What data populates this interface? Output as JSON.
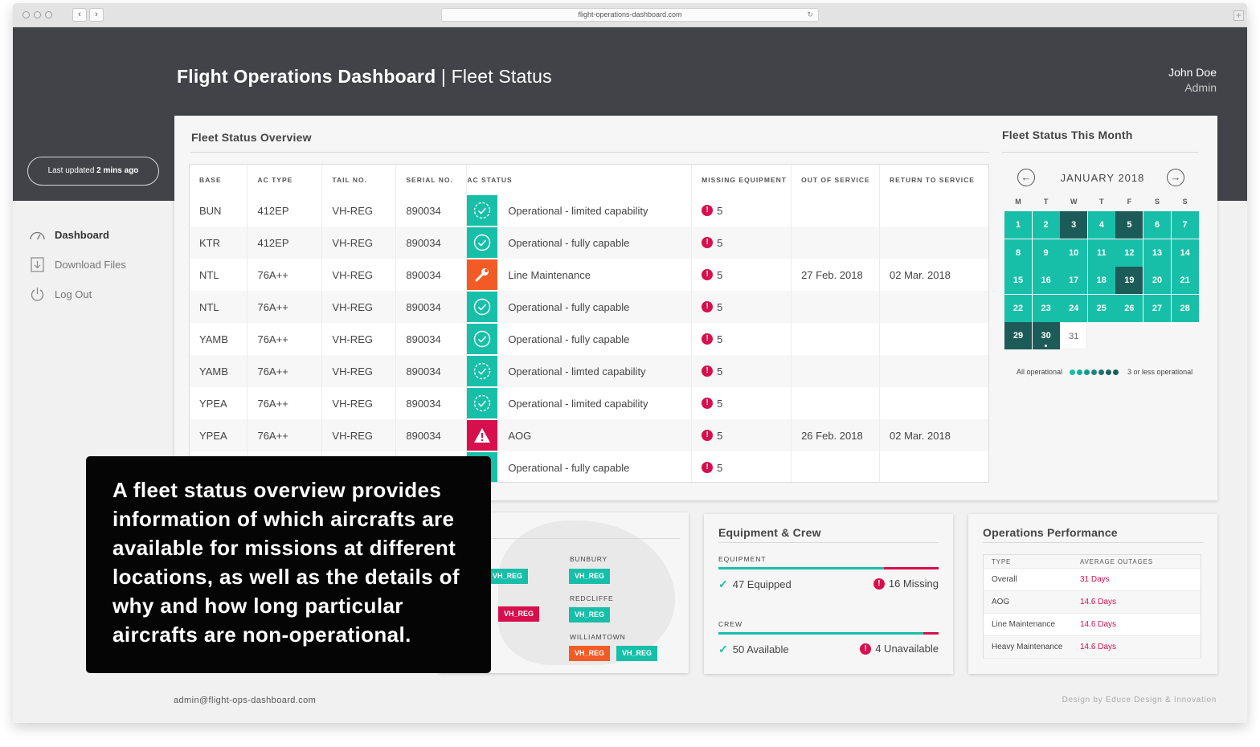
{
  "browser": {
    "url": "flight-operations-dashboard.com"
  },
  "header": {
    "title_main": "Flight Operations Dashboard",
    "title_sep": " | ",
    "title_sub": "Fleet Status",
    "user_name": "John Doe",
    "user_role": "Admin"
  },
  "sidebar": {
    "last_updated_prefix": "Last updated ",
    "last_updated_value": "2 mins ago",
    "items": [
      {
        "label": "Dashboard",
        "icon": "gauge-icon"
      },
      {
        "label": "Download Files",
        "icon": "download-icon"
      },
      {
        "label": "Log Out",
        "icon": "power-icon"
      }
    ]
  },
  "fleet": {
    "title": "Fleet Status Overview",
    "columns": [
      "BASE",
      "AC TYPE",
      "TAIL NO.",
      "SERIAL NO.",
      "AC STATUS",
      "MISSING EQUIPMENT",
      "OUT OF SERVICE",
      "RETURN TO SERVICE"
    ],
    "rows": [
      {
        "base": "BUN",
        "ac_type": "412EP",
        "tail": "VH-REG",
        "serial": "890034",
        "status": "Operational - limited capability",
        "status_kind": "limited",
        "missing": "5",
        "oos": "",
        "rts": ""
      },
      {
        "base": "KTR",
        "ac_type": "412EP",
        "tail": "VH-REG",
        "serial": "890034",
        "status": "Operational - fully capable",
        "status_kind": "full",
        "missing": "5",
        "oos": "",
        "rts": ""
      },
      {
        "base": "NTL",
        "ac_type": "76A++",
        "tail": "VH-REG",
        "serial": "890034",
        "status": "Line Maintenance",
        "status_kind": "maintenance",
        "missing": "5",
        "oos": "27 Feb. 2018",
        "rts": "02 Mar. 2018"
      },
      {
        "base": "NTL",
        "ac_type": "76A++",
        "tail": "VH-REG",
        "serial": "890034",
        "status": "Operational - fully capable",
        "status_kind": "full",
        "missing": "5",
        "oos": "",
        "rts": ""
      },
      {
        "base": "YAMB",
        "ac_type": "76A++",
        "tail": "VH-REG",
        "serial": "890034",
        "status": "Operational - fully capable",
        "status_kind": "full",
        "missing": "5",
        "oos": "",
        "rts": ""
      },
      {
        "base": "YAMB",
        "ac_type": "76A++",
        "tail": "VH-REG",
        "serial": "890034",
        "status": "Operational - limted capability",
        "status_kind": "limited",
        "missing": "5",
        "oos": "",
        "rts": ""
      },
      {
        "base": "YPEA",
        "ac_type": "76A++",
        "tail": "VH-REG",
        "serial": "890034",
        "status": "Operational - limited capability",
        "status_kind": "limited",
        "missing": "5",
        "oos": "",
        "rts": ""
      },
      {
        "base": "YPEA",
        "ac_type": "76A++",
        "tail": "VH-REG",
        "serial": "890034",
        "status": "AOG",
        "status_kind": "aog",
        "missing": "5",
        "oos": "26 Feb. 2018",
        "rts": "02 Mar. 2018"
      },
      {
        "base": "",
        "ac_type": "",
        "tail": "",
        "serial": "",
        "status": "Operational - fully capable",
        "status_kind": "full",
        "missing": "5",
        "oos": "",
        "rts": ""
      }
    ]
  },
  "calendar": {
    "title": "Fleet Status This Month",
    "month": "JANUARY 2018",
    "weekdays": [
      "M",
      "T",
      "W",
      "T",
      "F",
      "S",
      "S"
    ],
    "days": [
      {
        "d": "1",
        "s": "ok"
      },
      {
        "d": "2",
        "s": "ok"
      },
      {
        "d": "3",
        "s": "dk"
      },
      {
        "d": "4",
        "s": "ok"
      },
      {
        "d": "5",
        "s": "dk"
      },
      {
        "d": "6",
        "s": "ok"
      },
      {
        "d": "7",
        "s": "ok"
      },
      {
        "d": "8",
        "s": "ok"
      },
      {
        "d": "9",
        "s": "ok"
      },
      {
        "d": "10",
        "s": "ok"
      },
      {
        "d": "11",
        "s": "ok"
      },
      {
        "d": "12",
        "s": "ok"
      },
      {
        "d": "13",
        "s": "ok"
      },
      {
        "d": "14",
        "s": "ok"
      },
      {
        "d": "15",
        "s": "ok"
      },
      {
        "d": "16",
        "s": "ok"
      },
      {
        "d": "17",
        "s": "ok"
      },
      {
        "d": "18",
        "s": "ok"
      },
      {
        "d": "19",
        "s": "dk"
      },
      {
        "d": "20",
        "s": "ok"
      },
      {
        "d": "21",
        "s": "ok"
      },
      {
        "d": "22",
        "s": "ok"
      },
      {
        "d": "23",
        "s": "ok"
      },
      {
        "d": "24",
        "s": "ok"
      },
      {
        "d": "25",
        "s": "ok"
      },
      {
        "d": "26",
        "s": "ok"
      },
      {
        "d": "27",
        "s": "ok"
      },
      {
        "d": "28",
        "s": "ok"
      },
      {
        "d": "29",
        "s": "dk"
      },
      {
        "d": "30",
        "s": "dk",
        "today": true
      },
      {
        "d": "31",
        "s": "nd"
      }
    ],
    "legend_left": "All operational",
    "legend_right": "3 or less operational",
    "legend_colors": [
      "#17bfa9",
      "#15ad9c",
      "#139a8e",
      "#1a8580",
      "#1d7271",
      "#1e6363",
      "#1d5b59"
    ]
  },
  "overlay": {
    "text": "A fleet status overview provides information of which aircrafts are available for missions at different locations, as well as the details of why and how long particular aircrafts are non-operational."
  },
  "map": {
    "cities": [
      {
        "name": "BUNBURY",
        "tags": [
          {
            "t": "VH_REG",
            "c": "g"
          }
        ]
      },
      {
        "name": "REDCLIFFE",
        "tags": [
          {
            "t": "VH_REG",
            "c": "g"
          }
        ]
      },
      {
        "name": "WILLIAMTOWN",
        "tags": [
          {
            "t": "VH_REG",
            "c": "o"
          },
          {
            "t": "VH_REG",
            "c": "g"
          }
        ]
      }
    ],
    "left_tags": [
      {
        "t": "VH_REG",
        "c": "g"
      },
      {
        "t": "VH_REG",
        "c": "r"
      }
    ]
  },
  "equipment": {
    "title": "Equipment & Crew",
    "equip_label": "EQUIPMENT",
    "equipped": "47 Equipped",
    "missing": "16 Missing",
    "equip_ratio": 0.75,
    "crew_label": "CREW",
    "available": "50 Available",
    "unavailable": "4 Unavailable",
    "crew_ratio": 0.93
  },
  "ops": {
    "title": "Operations Performance",
    "col1": "TYPE",
    "col2": "AVERAGE OUTAGES",
    "rows": [
      {
        "type": "Overall",
        "val": "31 Days"
      },
      {
        "type": "AOG",
        "val": "14.6 Days"
      },
      {
        "type": "Line Maintenance",
        "val": "14.6 Days"
      },
      {
        "type": "Heavy Maintenance",
        "val": "14.6 Days"
      }
    ]
  },
  "footer": {
    "email": "admin@flight-ops-dashboard.com",
    "credit": "Design by Educe Design & Innovation"
  },
  "colors": {
    "teal": "#17bfa9",
    "dark_teal": "#1d5b59",
    "red": "#d80f4d",
    "orange": "#f25b25",
    "header": "#414349"
  }
}
